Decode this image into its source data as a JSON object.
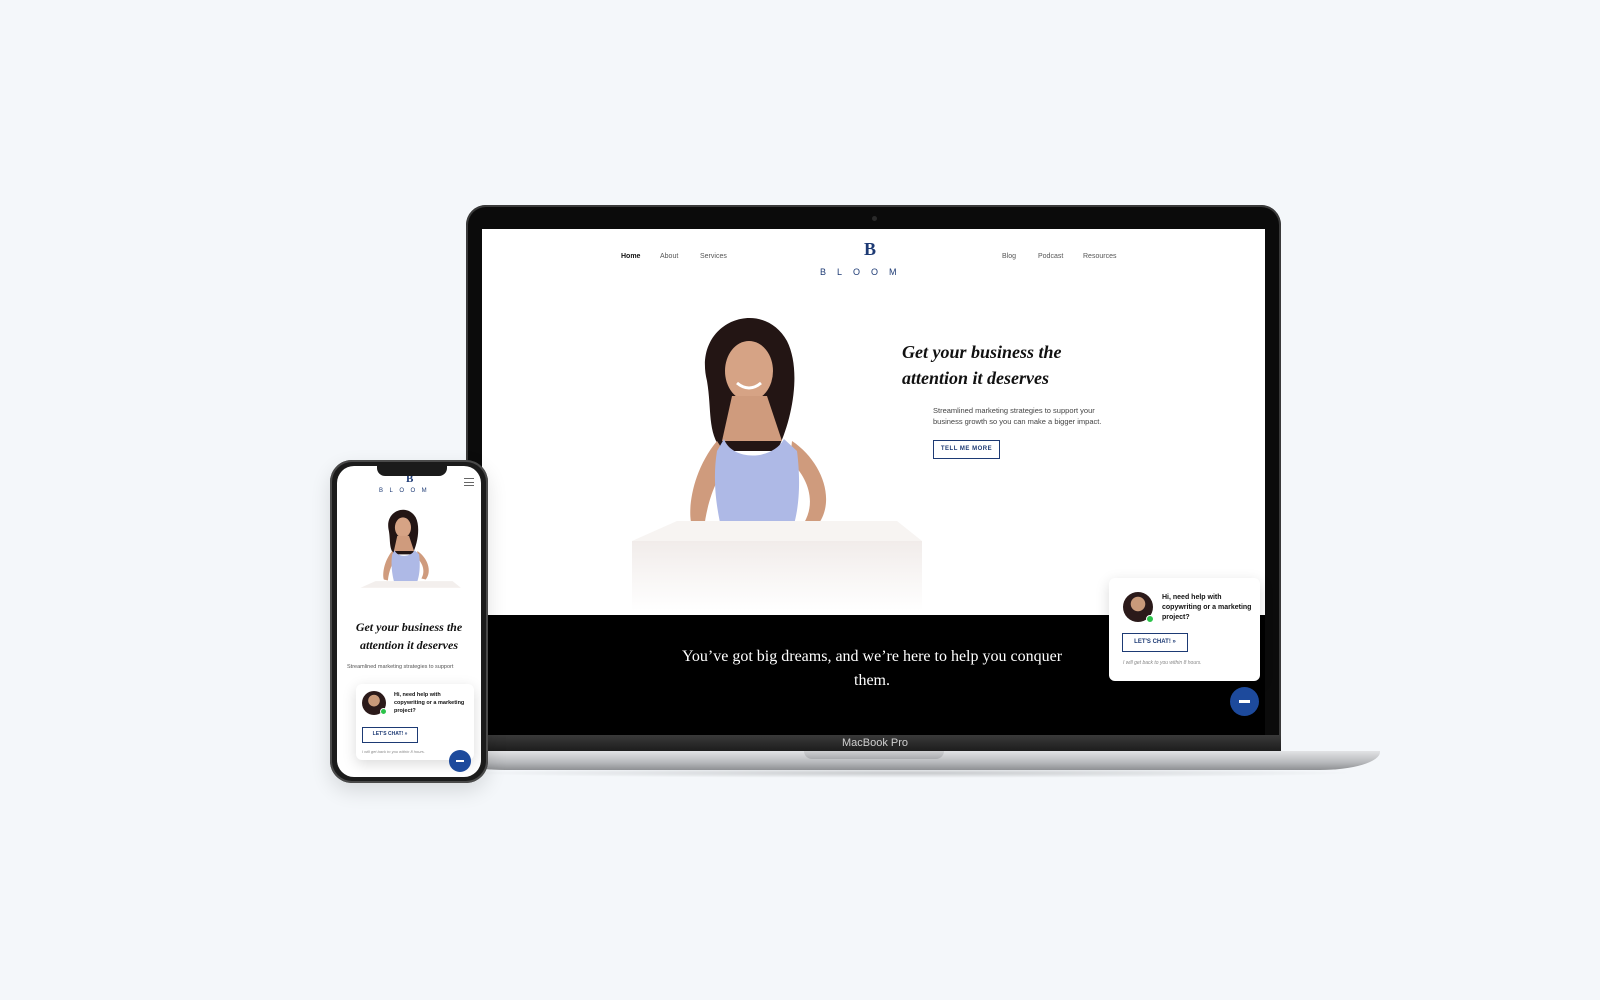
{
  "laptop_site": {
    "nav_left": [
      "Home",
      "About",
      "Services"
    ],
    "nav_right": [
      "Blog",
      "Podcast",
      "Resources"
    ],
    "logo_letter": "B",
    "logo_word": "BLOOM",
    "hero_title": "Get your business the attention it deserves",
    "hero_subtitle": "Streamlined marketing strategies to support your business growth so you can make a bigger impact.",
    "hero_button": "TELL ME MORE",
    "band_text": "You’ve got big dreams, and we’re here to help you conquer them."
  },
  "device_label": "MacBook Pro",
  "chat_widget": {
    "message": "Hi, need help with copywriting or a marketing project?",
    "button": "LET'S CHAT! »",
    "note": "I will get back to you within 8 hours."
  },
  "phone_site": {
    "logo_letter": "B",
    "logo_word": "BLOOM",
    "hero_title": "Get your business the attention it deserves",
    "hero_subtitle": "Streamlined marketing strategies to support"
  },
  "colors": {
    "brand": "#1d3a74",
    "accent_button": "#1d4a9c",
    "online": "#2bc34a"
  }
}
